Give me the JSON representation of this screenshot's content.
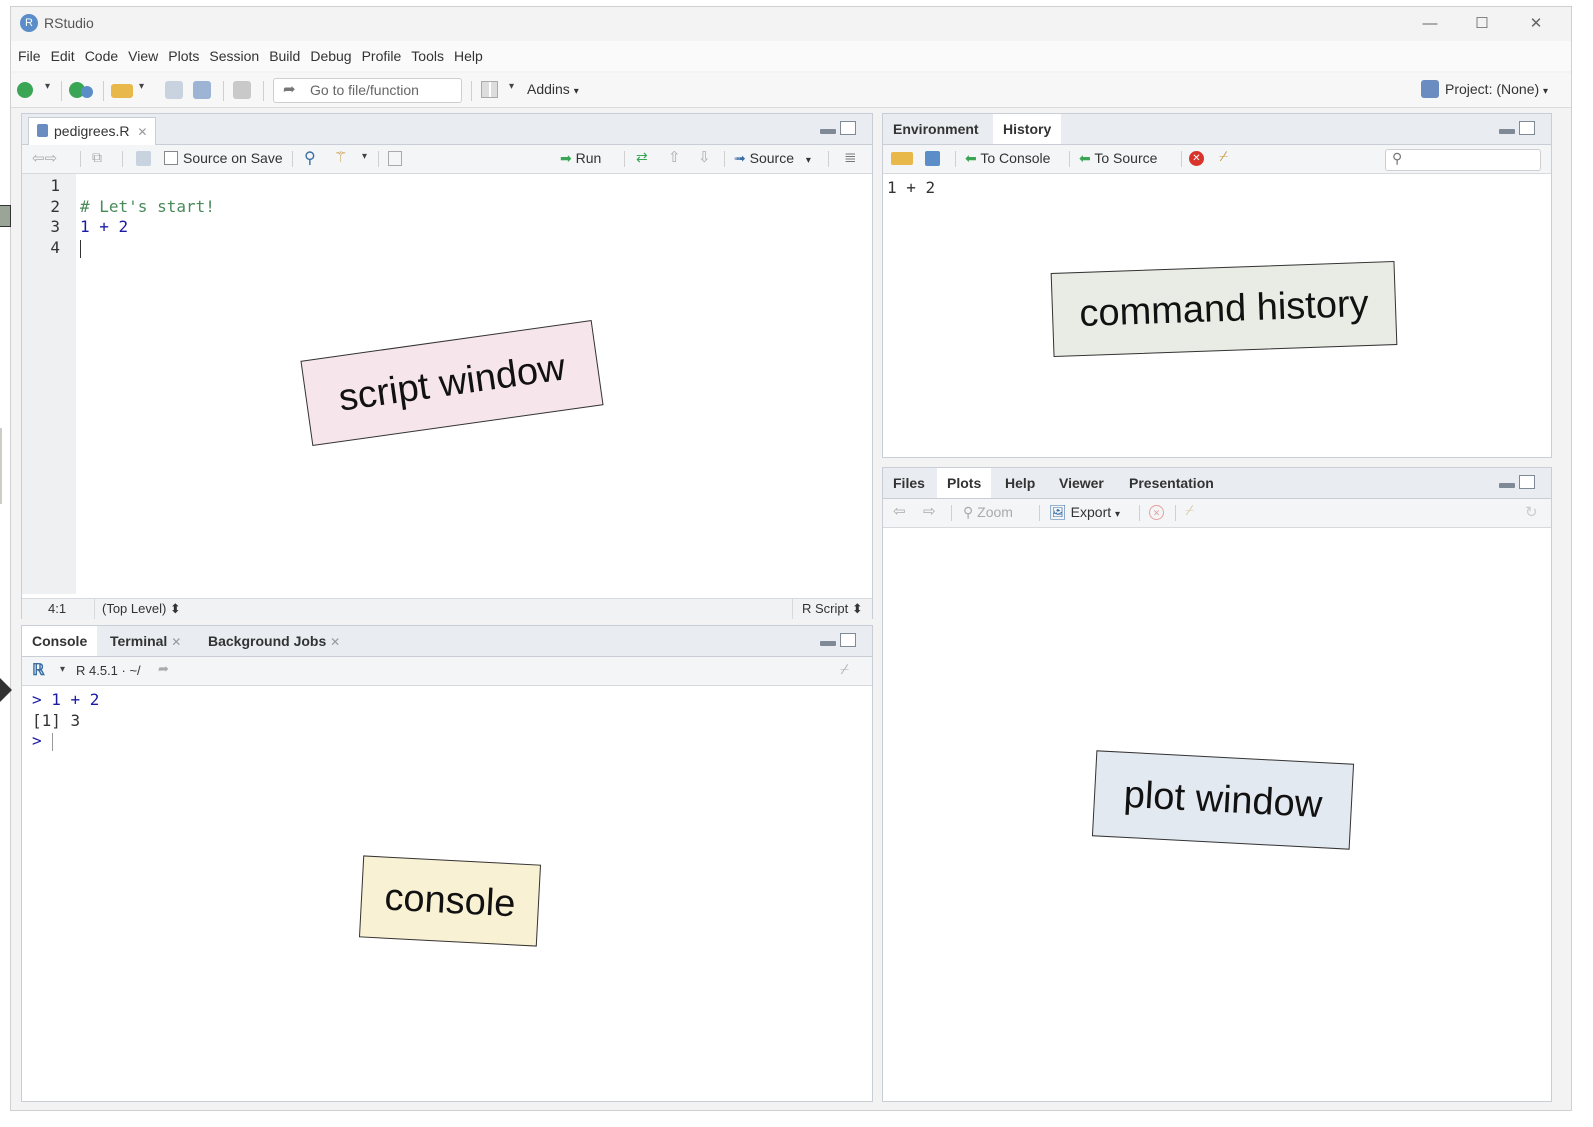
{
  "window": {
    "title": "RStudio",
    "logo_letter": "R",
    "minimize": "—",
    "maximize": "☐",
    "close": "✕"
  },
  "menu": [
    "File",
    "Edit",
    "Code",
    "View",
    "Plots",
    "Session",
    "Build",
    "Debug",
    "Profile",
    "Tools",
    "Help"
  ],
  "toolbar": {
    "goto_placeholder": "Go to file/function",
    "addins": "Addins",
    "project": "Project: (None)"
  },
  "script": {
    "tab_label": "pedigrees.R",
    "source_on_save": "Source on Save",
    "run": "Run",
    "source": "Source",
    "lines": [
      {
        "n": "1",
        "text": "",
        "kind": "plain"
      },
      {
        "n": "2",
        "text": "# Let's start!",
        "kind": "comment"
      },
      {
        "n": "3",
        "text": "1 + 2",
        "kind": "code"
      },
      {
        "n": "4",
        "text": "",
        "kind": "plain"
      }
    ],
    "status_pos": "4:1",
    "status_scope": "(Top Level) ⬍",
    "status_type": "R Script ⬍"
  },
  "console": {
    "tabs": [
      "Console",
      "Terminal",
      "Background Jobs"
    ],
    "r_version": "R 4.5.1 · ~/",
    "lines": [
      {
        "text": "> 1 + 2",
        "kind": "input"
      },
      {
        "text": "[1] 3",
        "kind": "output"
      },
      {
        "text": "> ",
        "kind": "input"
      }
    ]
  },
  "env": {
    "tabs": [
      "Environment",
      "History"
    ],
    "to_console": "To Console",
    "to_source": "To Source",
    "history": [
      "1 + 2"
    ]
  },
  "files": {
    "tabs": [
      "Files",
      "Plots",
      "Help",
      "Viewer",
      "Presentation"
    ],
    "zoom": "Zoom",
    "export": "Export"
  },
  "notes": {
    "script": "script window",
    "history": "command history",
    "console": "console",
    "plot": "plot window"
  },
  "colors": {
    "script_note": "#f6e6ec",
    "history_note": "#e9ece4",
    "console_note": "#f9f1d4",
    "plot_note": "#e3e9f1"
  }
}
